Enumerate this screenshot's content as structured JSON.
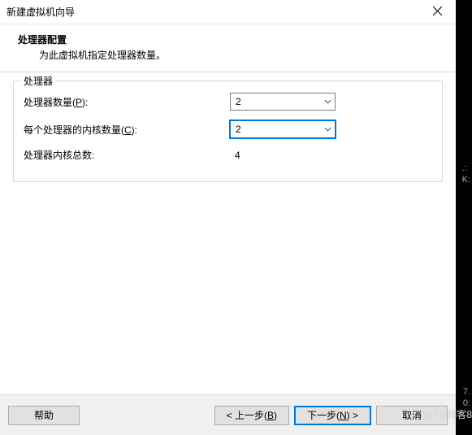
{
  "titlebar": {
    "text": "新建虚拟机向导"
  },
  "header": {
    "title": "处理器配置",
    "subtitle": "为此虚拟机指定处理器数量。"
  },
  "group": {
    "label": "处理器",
    "rows": {
      "processors": {
        "label_pre": "处理器数量(",
        "accel": "P",
        "label_post": "):",
        "value": "2"
      },
      "cores": {
        "label_pre": "每个处理器的内核数量(",
        "accel": "C",
        "label_post": "):",
        "value": "2"
      },
      "total": {
        "label": "处理器内核总数:",
        "value": "4"
      }
    }
  },
  "footer": {
    "help": "帮助",
    "back_pre": "< 上一步(",
    "back_accel": "B",
    "back_post": ")",
    "next_pre": "下一步(",
    "next_accel": "N",
    "next_post": ") >",
    "cancel": "取消"
  },
  "side": {
    "l1": ".:",
    "l2": "K:",
    "l3": "7.",
    "l4": "0:"
  },
  "watermark": "@ TO博客8"
}
